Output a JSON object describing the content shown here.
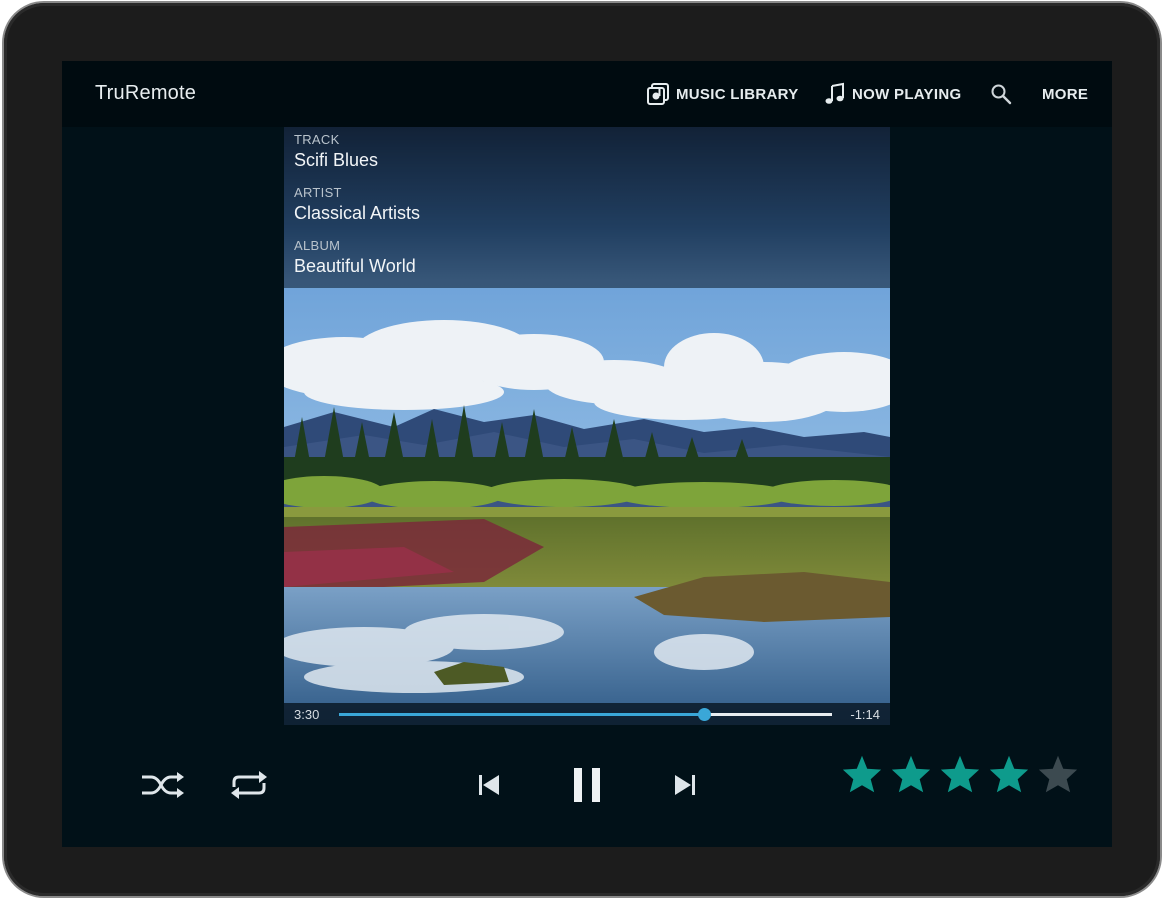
{
  "app": {
    "title": "TruRemote"
  },
  "toolbar": {
    "music_library": "MUSIC LIBRARY",
    "now_playing": "NOW PLAYING",
    "more": "MORE"
  },
  "now_playing": {
    "track_label": "TRACK",
    "track": "Scifi Blues",
    "artist_label": "ARTIST",
    "artist": "Classical Artists",
    "album_label": "ALBUM",
    "album": "Beautiful World"
  },
  "progress": {
    "elapsed": "3:30",
    "remaining": "-1:14",
    "fraction": 0.74
  },
  "controls": {
    "shuffle": "shuffle-icon",
    "repeat": "repeat-icon",
    "previous": "skip-previous-icon",
    "play_pause": "pause-icon",
    "next": "skip-next-icon"
  },
  "rating": {
    "value": 4,
    "max": 5
  },
  "colors": {
    "accent": "#3aa7d8",
    "star_filled": "#0e9b8c",
    "star_empty": "#3c4a50",
    "background": "#011118"
  }
}
